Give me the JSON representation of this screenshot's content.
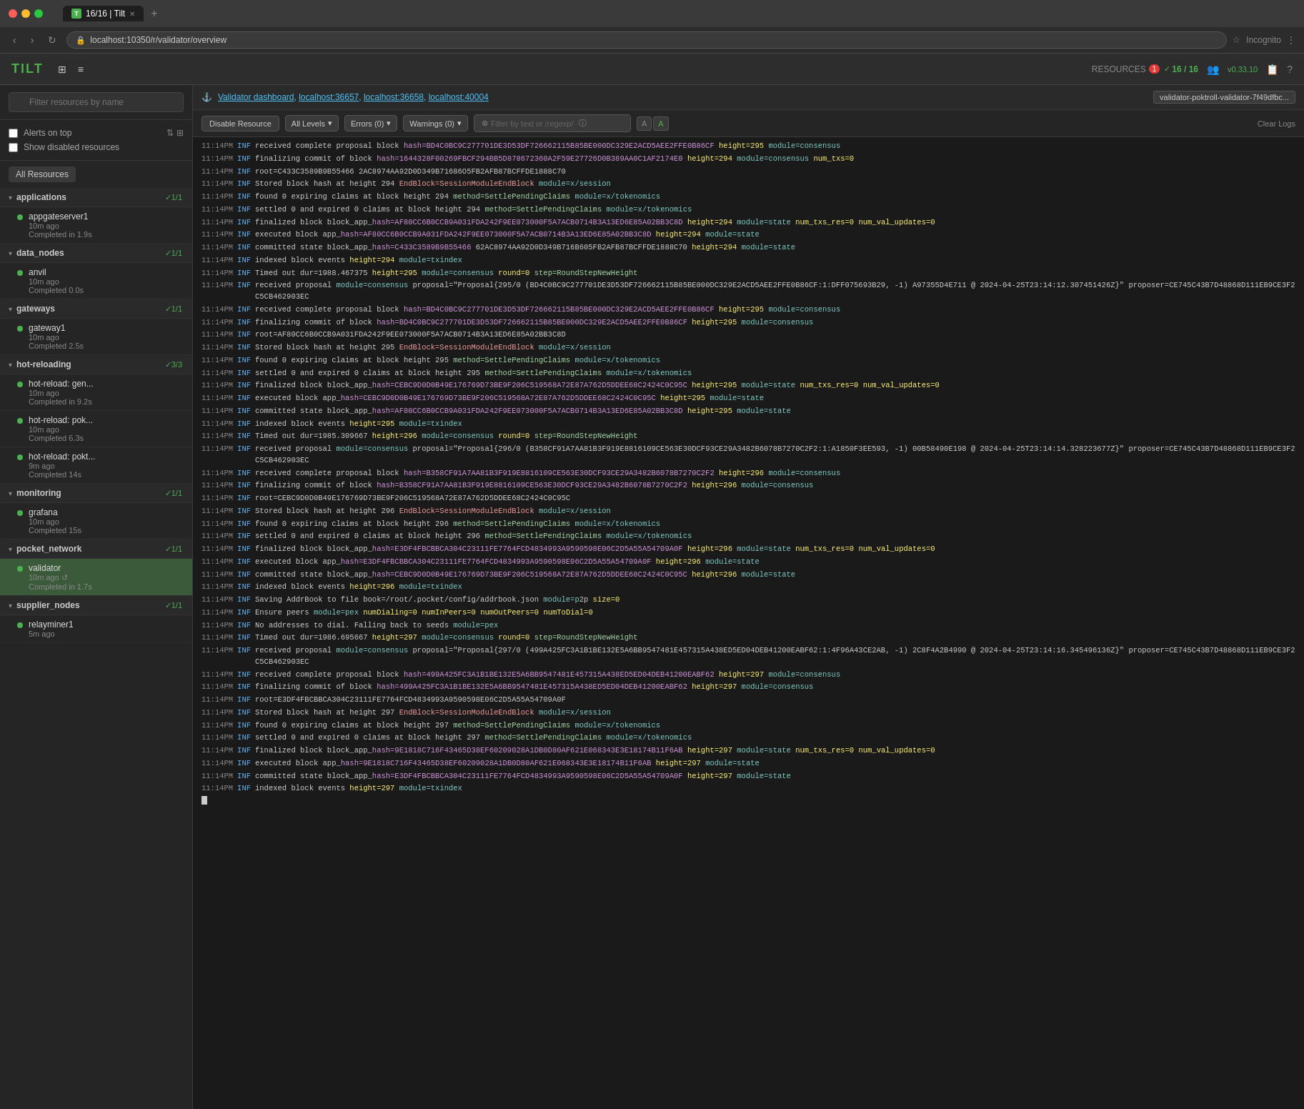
{
  "browser": {
    "tabs": [
      {
        "id": "tab1",
        "label": "16/16 | Tilt",
        "active": true,
        "icon": "T"
      }
    ],
    "address": "localhost:10350/r/validator/overview",
    "incognito": "Incognito"
  },
  "header": {
    "logo": "TILT",
    "resources_label": "RESOURCES",
    "alert_count": "1",
    "checkmark": "✓",
    "resources_fraction": "16 / 16",
    "version": "v0.33.10"
  },
  "sidebar": {
    "search_placeholder": "Filter resources by name",
    "alerts_on_top": "Alerts on top",
    "show_disabled": "Show disabled resources",
    "all_resources": "All Resources",
    "groups": [
      {
        "name": "applications",
        "status": "✓1/1",
        "items": [
          {
            "name": "appgateserver1",
            "time": "10m ago",
            "completed": "Completed in 1.9s",
            "active": false
          }
        ]
      },
      {
        "name": "data_nodes",
        "status": "✓1/1",
        "items": [
          {
            "name": "anvil",
            "time": "10m ago",
            "completed": "Completed 0.0s",
            "active": false
          }
        ]
      },
      {
        "name": "gateways",
        "status": "✓1/1",
        "items": [
          {
            "name": "gateway1",
            "time": "10m ago",
            "completed": "Completed 2.5s",
            "active": false
          }
        ]
      },
      {
        "name": "hot-reloading",
        "status": "✓3/3",
        "items": [
          {
            "name": "hot-reload: gen...",
            "time": "10m ago",
            "completed": "Completed in 9.2s",
            "active": false
          },
          {
            "name": "hot-reload: pok...",
            "time": "10m ago",
            "completed": "Completed 6.3s",
            "active": false
          },
          {
            "name": "hot-reload: pokt...",
            "time": "9m ago",
            "completed": "Completed 14s",
            "active": false
          }
        ]
      },
      {
        "name": "monitoring",
        "status": "✓1/1",
        "items": [
          {
            "name": "grafana",
            "time": "10m ago",
            "completed": "Completed 15s",
            "active": false
          }
        ]
      },
      {
        "name": "pocket_network",
        "status": "✓1/1",
        "items": [
          {
            "name": "validator",
            "time": "10m ago",
            "completed": "Completed in 1.7s",
            "active": true
          }
        ]
      },
      {
        "name": "supplier_nodes",
        "status": "✓1/1",
        "items": [
          {
            "name": "relayminer1",
            "time": "5m ago",
            "completed": "",
            "active": false
          }
        ]
      }
    ]
  },
  "panel": {
    "title_prefix": "⚓",
    "title_links": [
      "Validator dashboard",
      "localhost:36657",
      "localhost:36658",
      "localhost:40004"
    ],
    "copy_btn": "validator-poktroll-validator-7f49dfbc...",
    "disable_btn": "Disable Resource",
    "level_label": "All Levels",
    "errors_label": "Errors (0)",
    "warnings_label": "Warnings (0)",
    "filter_placeholder": "Filter by text or /regexp/",
    "case_a": "A",
    "case_a2": "A",
    "clear_logs": "Clear Logs"
  },
  "logs": [
    {
      "time": "11:14PM",
      "level": "INF",
      "msg": "received complete proposal block hash=BD4C0BC9C277701DE3D53DF726662115B85BE000DC329E2ACD5AEE2FFE0B86CF height=295 module=consensus"
    },
    {
      "time": "11:14PM",
      "level": "INF",
      "msg": "finalizing commit of block hash=1644328F00269FBCF294BB5D878672360A2F59E27726D0B389AA0C1AF2174E0 height=294 module=consensus num_txs=0"
    },
    {
      "time": "11:14PM",
      "level": "INF",
      "msg": "root=C433C3589B9B55466 2AC8974AA92D0D349B71686O5FB2AFB87BCFFDE1888C70"
    },
    {
      "time": "11:14PM",
      "level": "INF",
      "msg": "Stored block hash at height 294 EndBlock=SessionModuleEndBlock module=x/session"
    },
    {
      "time": "11:14PM",
      "level": "INF",
      "msg": "found 0 expiring claims at block height 294 method=SettlePendingClaims module=x/tokenomics"
    },
    {
      "time": "11:14PM",
      "level": "INF",
      "msg": "settled 0 and expired 0 claims at block height 294 method=SettlePendingClaims module=x/tokenomics"
    },
    {
      "time": "11:14PM",
      "level": "INF",
      "msg": "finalized block block_app_hash=AF80CC6B0CCB9A031FDA242F9EE073000F5A7ACB0714B3A13ED6E85A02BB3C8D height=294 module=state num_txs_res=0 num_val_updates=0"
    },
    {
      "time": "11:14PM",
      "level": "INF",
      "msg": "executed block app_hash=AF80CC6B0CCB9A031FDA242F9EE073000F5A7ACB0714B3A13ED6E85A02BB3C8D height=294 module=state"
    },
    {
      "time": "11:14PM",
      "level": "INF",
      "msg": "committed state block_app_hash=C433C3589B9B55466 62AC8974AA92D0D349B716B605FB2AFB87BCFFDE1888C70 height=294 module=state"
    },
    {
      "time": "11:14PM",
      "level": "INF",
      "msg": "indexed block events height=294 module=txindex"
    },
    {
      "time": "11:14PM",
      "level": "INF",
      "msg": "Timed out dur=1988.467375 height=295 module=consensus round=0 step=RoundStepNewHeight"
    },
    {
      "time": "11:14PM",
      "level": "INF",
      "msg": "received proposal module=consensus proposal=\"Proposal{295/0 (BD4C0BC9C277701DE3D53DF726662115B85BE000DC329E2ACD5AEE2FFE0B86CF:1:DFF075693B29, -1) A97355D4E711 @ 2024-04-25T23:14:12.307451426Z}\" proposer=CE745C43B7D48868D111EB9CE3F2C5CB462903EC"
    },
    {
      "time": "11:14PM",
      "level": "INF",
      "msg": "received complete proposal block hash=BD4C0BC9C277701DE3D53DF726662115B85BE000DC329E2ACD5AEE2FFE0B86CF height=295 module=consensus"
    },
    {
      "time": "11:14PM",
      "level": "INF",
      "msg": "finalizing commit of block hash=BD4C0BC9C277701DE3D53DF726662115B85BE000DC329E2ACD5AEE2FFE0B86CF height=295 module=consensus"
    },
    {
      "time": "11:14PM",
      "level": "INF",
      "msg": "root=AF80CC6B0CCB9A031FDA242F9EE073000F5A7ACB0714B3A13ED6E85A02BB3C8D"
    },
    {
      "time": "11:14PM",
      "level": "INF",
      "msg": "Stored block hash at height 295 EndBlock=SessionModuleEndBlock module=x/session"
    },
    {
      "time": "11:14PM",
      "level": "INF",
      "msg": "found 0 expiring claims at block height 295 method=SettlePendingClaims module=x/tokenomics"
    },
    {
      "time": "11:14PM",
      "level": "INF",
      "msg": "settled 0 and expired 0 claims at block height 295 method=SettlePendingClaims module=x/tokenomics"
    },
    {
      "time": "11:14PM",
      "level": "INF",
      "msg": "finalized block block_app_hash=CEBC9D0D0B49E176769D73BE9F206C519568A72E87A762D5DDEE68C2424C0C95C height=295 module=state num_txs_res=0 num_val_updates=0"
    },
    {
      "time": "11:14PM",
      "level": "INF",
      "msg": "executed block app_hash=CEBC9D0D0B49E176769D73BE9F206C519568A72E87A762D5DDEE68C2424C0C95C height=295 module=state"
    },
    {
      "time": "11:14PM",
      "level": "INF",
      "msg": "committed state block_app_hash=AF80CC6B0CCB9A031FDA242F9EE073000F5A7ACB0714B3A13ED6E85A02BB3C8D height=295 module=state"
    },
    {
      "time": "11:14PM",
      "level": "INF",
      "msg": "indexed block events height=295 module=txindex"
    },
    {
      "time": "11:14PM",
      "level": "INF",
      "msg": "Timed out dur=1985.309667 height=296 module=consensus round=0 step=RoundStepNewHeight"
    },
    {
      "time": "11:14PM",
      "level": "INF",
      "msg": "received proposal module=consensus proposal=\"Proposal{296/0 (B358CF91A7AA81B3F919E8816109CE563E30DCF93CE29A3482B6078B7270C2F2:1:A1850F3EE593, -1) 00B58490E198 @ 2024-04-25T23:14:14.328223677Z}\" proposer=CE745C43B7D48868D111EB9CE3F2C5CB462903EC"
    },
    {
      "time": "11:14PM",
      "level": "INF",
      "msg": "received complete proposal block hash=B358CF91A7AA81B3F919E8816109CE563E30DCF93CE29A3482B6078B7270C2F2 height=296 module=consensus"
    },
    {
      "time": "11:14PM",
      "level": "INF",
      "msg": "finalizing commit of block hash=B358CF91A7AA81B3F919E8816109CE563E30DCF93CE29A3482B6078B7270C2F2 height=296 module=consensus"
    },
    {
      "time": "11:14PM",
      "level": "INF",
      "msg": "root=CEBC9D0D0B49E176769D73BE9F206C519568A72E87A762D5DDEE68C2424C0C95C"
    },
    {
      "time": "11:14PM",
      "level": "INF",
      "msg": "Stored block hash at height 296 EndBlock=SessionModuleEndBlock module=x/session"
    },
    {
      "time": "11:14PM",
      "level": "INF",
      "msg": "found 0 expiring claims at block height 296 method=SettlePendingClaims module=x/tokenomics"
    },
    {
      "time": "11:14PM",
      "level": "INF",
      "msg": "settled 0 and expired 0 claims at block height 296 method=SettlePendingClaims module=x/tokenomics"
    },
    {
      "time": "11:14PM",
      "level": "INF",
      "msg": "finalized block block_app_hash=E3DF4FBCBBCA304C23111FE7764FCD4834993A9590598E06C2D5A55A54709A0F height=296 module=state num_txs_res=0 num_val_updates=0"
    },
    {
      "time": "11:14PM",
      "level": "INF",
      "msg": "executed block app_hash=E3DF4FBCBBCA304C23111FE7764FCD4834993A9590598E06C2D5A55A54709A0F height=296 module=state"
    },
    {
      "time": "11:14PM",
      "level": "INF",
      "msg": "committed state block_app_hash=CEBC9D0D0B49E176769D73BE9F206C519568A72E87A762D5DDEE68C2424C0C95C height=296 module=state"
    },
    {
      "time": "11:14PM",
      "level": "INF",
      "msg": "indexed block events height=296 module=txindex"
    },
    {
      "time": "11:14PM",
      "level": "INF",
      "msg": "Saving AddrBook to file book=/root/.pocket/config/addrbook.json module=p2p size=0"
    },
    {
      "time": "11:14PM",
      "level": "INF",
      "msg": "Ensure peers module=pex numDialing=0 numInPeers=0 numOutPeers=0 numToDial=0"
    },
    {
      "time": "11:14PM",
      "level": "INF",
      "msg": "No addresses to dial. Falling back to seeds module=pex"
    },
    {
      "time": "11:14PM",
      "level": "INF",
      "msg": "Timed out dur=1986.695667 height=297 module=consensus round=0 step=RoundStepNewHeight"
    },
    {
      "time": "11:14PM",
      "level": "INF",
      "msg": "received proposal module=consensus proposal=\"Proposal{297/0 (499A425FC3A1B1BE132E5A6BB9547481E457315A438ED5ED04DEB41200EABF62:1:4F96A43CE2AB, -1) 2C8F4A2B4990 @ 2024-04-25T23:14:16.345496136Z}\" proposer=CE745C43B7D48868D111EB9CE3F2C5CB462903EC"
    },
    {
      "time": "11:14PM",
      "level": "INF",
      "msg": "received complete proposal block hash=499A425FC3A1B1BE132E5A6BB9547481E457315A438ED5ED04DEB41200EABF62 height=297 module=consensus"
    },
    {
      "time": "11:14PM",
      "level": "INF",
      "msg": "finalizing commit of block hash=499A425FC3A1B1BE132E5A6BB9547481E457315A438ED5ED04DEB41200EABF62 height=297 module=consensus"
    },
    {
      "time": "11:14PM",
      "level": "INF",
      "msg": "root=E3DF4FBCBBCA304C23111FE7764FCD4834993A9590598E06C2D5A55A54709A0F"
    },
    {
      "time": "11:14PM",
      "level": "INF",
      "msg": "Stored block hash at height 297 EndBlock=SessionModuleEndBlock module=x/session"
    },
    {
      "time": "11:14PM",
      "level": "INF",
      "msg": "found 0 expiring claims at block height 297 method=SettlePendingClaims module=x/tokenomics"
    },
    {
      "time": "11:14PM",
      "level": "INF",
      "msg": "settled 0 and expired 0 claims at block height 297 method=SettlePendingClaims module=x/tokenomics"
    },
    {
      "time": "11:14PM",
      "level": "INF",
      "msg": "finalized block block_app_hash=9E1818C716F43465D38EF60209028A1DB0D80AF621E068343E3E18174B11F6AB height=297 module=state num_txs_res=0 num_val_updates=0"
    },
    {
      "time": "11:14PM",
      "level": "INF",
      "msg": "executed block app_hash=9E1818C716F43465D38EF60209028A1DB0D80AF621E068343E3E18174B11F6AB height=297 module=state"
    },
    {
      "time": "11:14PM",
      "level": "INF",
      "msg": "committed state block_app_hash=E3DF4FBCBBCA304C23111FE7764FCD4834993A9590598E06C2D5A55A54709A0F height=297 module=state"
    },
    {
      "time": "11:14PM",
      "level": "INF",
      "msg": "indexed block events height=297 module=txindex"
    }
  ]
}
